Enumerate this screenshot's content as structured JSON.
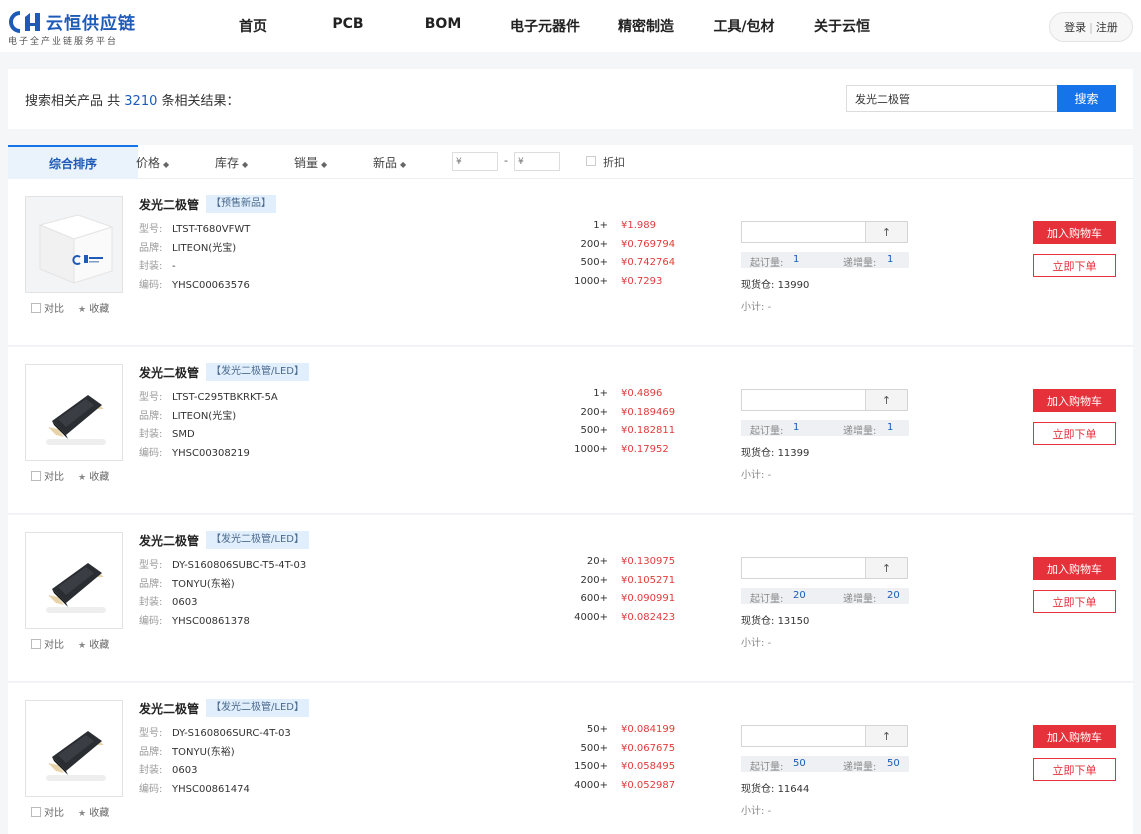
{
  "header": {
    "logo_name": "云恒供应链",
    "logo_slogan": "电子全产业链服务平台",
    "nav": [
      "首页",
      "PCB",
      "BOM",
      "电子元器件",
      "精密制造",
      "工具/包材",
      "关于云恒"
    ],
    "login": "登录",
    "register": "注册",
    "separator": "|"
  },
  "search": {
    "prefix": "搜索相关产品 共",
    "count": "3210",
    "suffix": "条相关结果：",
    "query": "发光二极管",
    "button": "搜索"
  },
  "sortbar": {
    "active": "综合排序",
    "price": "价格",
    "stock": "库存",
    "sales": "销量",
    "new": "新品",
    "price_min_placeholder": "¥",
    "price_max_placeholder": "¥",
    "dash": "-",
    "discount": "折扣",
    "arrow": "◆"
  },
  "labels": {
    "model": "型号:",
    "brand": "品牌:",
    "package": "封装:",
    "code": "编码:",
    "moq": "起订量:",
    "increment": "递增量:",
    "stock": "现货仓:",
    "subtotal": "小计:",
    "add_to_cart": "加入购物车",
    "buy_now": "立即下单",
    "compare": "对比",
    "favorite": "收藏",
    "star": "★",
    "up_arrow": "↑"
  },
  "products": [
    {
      "name": "发光二极管",
      "tag": "【预售新品】",
      "model": "LTST-T680VFWT",
      "brand": "LITEON(光宝)",
      "package": "-",
      "code": "YHSC00063576",
      "tiers": [
        [
          "1+",
          "¥1.989"
        ],
        [
          "200+",
          "¥0.769794"
        ],
        [
          "500+",
          "¥0.742764"
        ],
        [
          "1000+",
          "¥0.7293"
        ]
      ],
      "moq": "1",
      "increment": "1",
      "stock": "13990",
      "subtotal": "-",
      "image": "box"
    },
    {
      "name": "发光二极管",
      "tag": "【发光二极管/LED】",
      "model": "LTST-C295TBKRKT-5A",
      "brand": "LITEON(光宝)",
      "package": "SMD",
      "code": "YHSC00308219",
      "tiers": [
        [
          "1+",
          "¥0.4896"
        ],
        [
          "200+",
          "¥0.189469"
        ],
        [
          "500+",
          "¥0.182811"
        ],
        [
          "1000+",
          "¥0.17952"
        ]
      ],
      "moq": "1",
      "increment": "1",
      "stock": "11399",
      "subtotal": "-",
      "image": "chip"
    },
    {
      "name": "发光二极管",
      "tag": "【发光二极管/LED】",
      "model": "DY-S160806SUBC-T5-4T-03",
      "brand": "TONYU(东裕)",
      "package": "0603",
      "code": "YHSC00861378",
      "tiers": [
        [
          "20+",
          "¥0.130975"
        ],
        [
          "200+",
          "¥0.105271"
        ],
        [
          "600+",
          "¥0.090991"
        ],
        [
          "4000+",
          "¥0.082423"
        ]
      ],
      "moq": "20",
      "increment": "20",
      "stock": "13150",
      "subtotal": "-",
      "image": "chip"
    },
    {
      "name": "发光二极管",
      "tag": "【发光二极管/LED】",
      "model": "DY-S160806SURC-4T-03",
      "brand": "TONYU(东裕)",
      "package": "0603",
      "code": "YHSC00861474",
      "tiers": [
        [
          "50+",
          "¥0.084199"
        ],
        [
          "500+",
          "¥0.067675"
        ],
        [
          "1500+",
          "¥0.058495"
        ],
        [
          "4000+",
          "¥0.052987"
        ]
      ],
      "moq": "50",
      "increment": "50",
      "stock": "11644",
      "subtotal": "-",
      "image": "chip"
    }
  ],
  "colors": {
    "brand_blue": "#1673ea",
    "price_red": "#e23a3a",
    "cart_red": "#e5323a"
  }
}
